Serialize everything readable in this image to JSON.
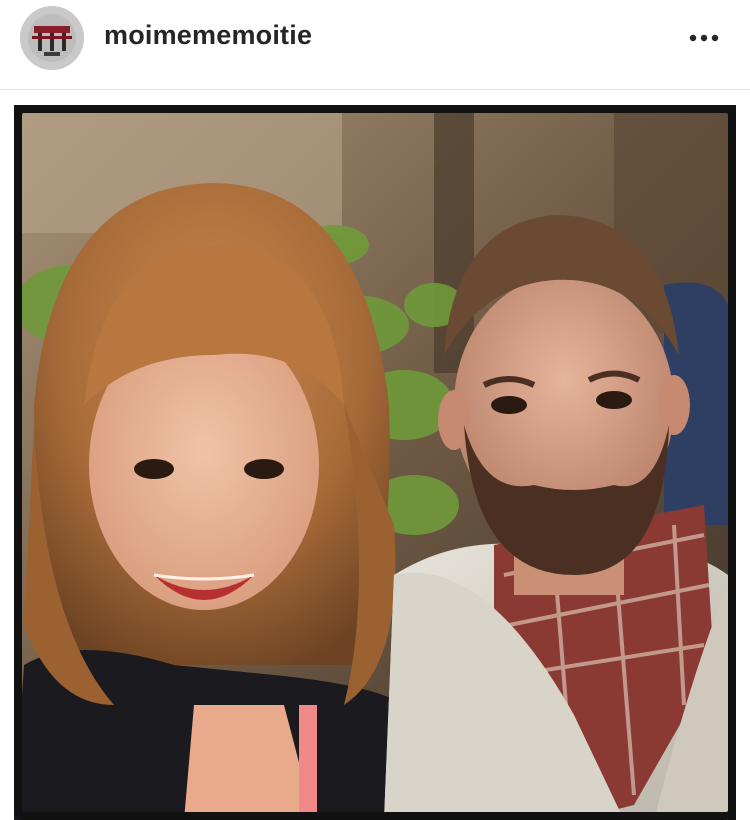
{
  "post": {
    "username": "moimememoitie",
    "avatar_icon": "profile-avatar",
    "more_icon": "more-options-icon"
  },
  "photo": {
    "description_icon": "post-photo"
  },
  "colors": {
    "username": "#262626",
    "divider": "#e6e6e6",
    "frame": "#111111"
  }
}
